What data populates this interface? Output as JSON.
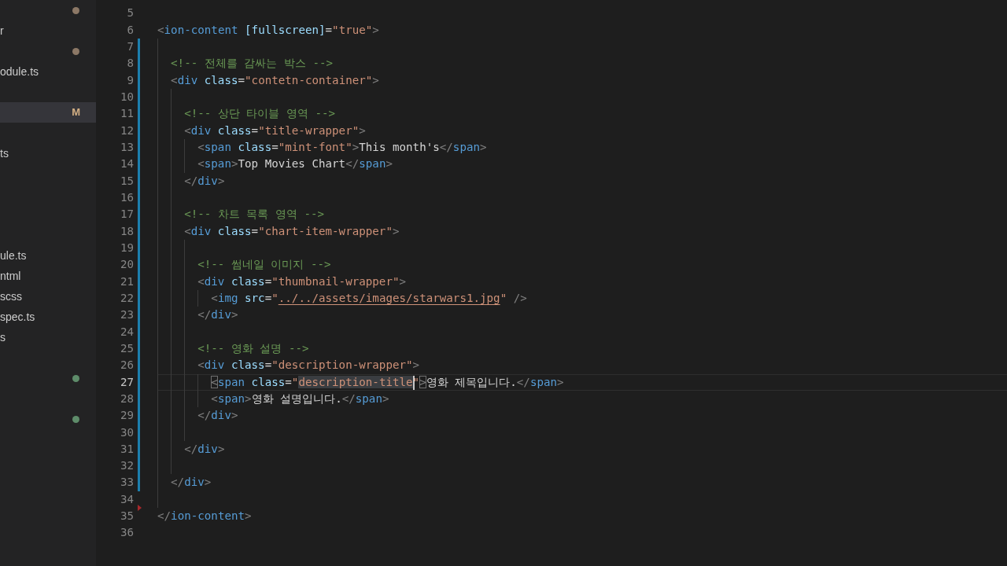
{
  "sidebar": {
    "items": [
      {
        "selected": false,
        "color": "#8c7866"
      },
      {
        "selected": false,
        "label": "r"
      },
      {
        "selected": false,
        "color": "#8c7866"
      },
      {
        "selected": false,
        "label": "odule.ts"
      },
      {
        "selected": false
      },
      {
        "selected": true,
        "badge": "M"
      },
      {
        "selected": false
      },
      {
        "selected": false,
        "label": "ts"
      },
      {
        "selected": false
      },
      {
        "selected": false
      },
      {
        "selected": false
      },
      {
        "selected": false
      },
      {
        "selected": false,
        "label": "ule.ts"
      },
      {
        "selected": false,
        "label": "ntml"
      },
      {
        "selected": false,
        "label": "scss"
      },
      {
        "selected": false,
        "label": "spec.ts"
      },
      {
        "selected": false,
        "label": "s"
      },
      {
        "selected": false
      },
      {
        "selected": false,
        "color": "#5e8c6a"
      },
      {
        "selected": false
      },
      {
        "selected": false,
        "color": "#5e8c6a"
      }
    ]
  },
  "editor": {
    "lines": [
      {
        "number": "5",
        "modified": false,
        "deleted": false,
        "current": false
      },
      {
        "number": "6",
        "modified": false,
        "deleted": false,
        "current": false,
        "tokens": [
          {
            "kind": "punct",
            "text": "<"
          },
          {
            "kind": "tag",
            "text": "ion-content"
          },
          {
            "kind": "attr",
            "text": " [fullscreen]"
          },
          {
            "kind": "op",
            "text": "="
          },
          {
            "kind": "string",
            "text": "\"true\""
          },
          {
            "kind": "punct",
            "text": ">"
          }
        ]
      },
      {
        "number": "7",
        "modified": true,
        "deleted": false,
        "current": false
      },
      {
        "number": "8",
        "modified": true,
        "deleted": false,
        "current": false,
        "tokens": [
          {
            "kind": "comment",
            "text": "  <!-- 전체를 감싸는 박스 -->"
          }
        ]
      },
      {
        "number": "9",
        "modified": true,
        "deleted": false,
        "current": false,
        "tokens": [
          {
            "kind": "punct",
            "text": "  <"
          },
          {
            "kind": "tag",
            "text": "div"
          },
          {
            "kind": "attr",
            "text": " class"
          },
          {
            "kind": "op",
            "text": "="
          },
          {
            "kind": "string",
            "text": "\"contetn-container\""
          },
          {
            "kind": "punct",
            "text": ">"
          }
        ]
      },
      {
        "number": "10",
        "modified": true,
        "deleted": false,
        "current": false
      },
      {
        "number": "11",
        "modified": true,
        "deleted": false,
        "current": false,
        "tokens": [
          {
            "kind": "comment",
            "text": "    <!-- 상단 타이블 영역 -->"
          }
        ]
      },
      {
        "number": "12",
        "modified": true,
        "deleted": false,
        "current": false,
        "tokens": [
          {
            "kind": "punct",
            "text": "    <"
          },
          {
            "kind": "tag",
            "text": "div"
          },
          {
            "kind": "attr",
            "text": " class"
          },
          {
            "kind": "op",
            "text": "="
          },
          {
            "kind": "string",
            "text": "\"title-wrapper\""
          },
          {
            "kind": "punct",
            "text": ">"
          }
        ]
      },
      {
        "number": "13",
        "modified": true,
        "deleted": false,
        "current": false,
        "tokens": [
          {
            "kind": "punct",
            "text": "      <"
          },
          {
            "kind": "tag",
            "text": "span"
          },
          {
            "kind": "attr",
            "text": " class"
          },
          {
            "kind": "op",
            "text": "="
          },
          {
            "kind": "string",
            "text": "\"mint-font\""
          },
          {
            "kind": "punct",
            "text": ">"
          },
          {
            "kind": "text",
            "text": "This month's"
          },
          {
            "kind": "punct",
            "text": "</"
          },
          {
            "kind": "tag",
            "text": "span"
          },
          {
            "kind": "punct",
            "text": ">"
          }
        ]
      },
      {
        "number": "14",
        "modified": true,
        "deleted": false,
        "current": false,
        "tokens": [
          {
            "kind": "punct",
            "text": "      <"
          },
          {
            "kind": "tag",
            "text": "span"
          },
          {
            "kind": "punct",
            "text": ">"
          },
          {
            "kind": "text",
            "text": "Top Movies Chart"
          },
          {
            "kind": "punct",
            "text": "</"
          },
          {
            "kind": "tag",
            "text": "span"
          },
          {
            "kind": "punct",
            "text": ">"
          }
        ]
      },
      {
        "number": "15",
        "modified": true,
        "deleted": false,
        "current": false,
        "tokens": [
          {
            "kind": "punct",
            "text": "    </"
          },
          {
            "kind": "tag",
            "text": "div"
          },
          {
            "kind": "punct",
            "text": ">"
          }
        ]
      },
      {
        "number": "16",
        "modified": true,
        "deleted": false,
        "current": false
      },
      {
        "number": "17",
        "modified": true,
        "deleted": false,
        "current": false,
        "tokens": [
          {
            "kind": "comment",
            "text": "    <!-- 차트 목록 영역 -->"
          }
        ]
      },
      {
        "number": "18",
        "modified": true,
        "deleted": false,
        "current": false,
        "tokens": [
          {
            "kind": "punct",
            "text": "    <"
          },
          {
            "kind": "tag",
            "text": "div"
          },
          {
            "kind": "attr",
            "text": " class"
          },
          {
            "kind": "op",
            "text": "="
          },
          {
            "kind": "string",
            "text": "\"chart-item-wrapper\""
          },
          {
            "kind": "punct",
            "text": ">"
          }
        ]
      },
      {
        "number": "19",
        "modified": true,
        "deleted": false,
        "current": false
      },
      {
        "number": "20",
        "modified": true,
        "deleted": false,
        "current": false,
        "tokens": [
          {
            "kind": "comment",
            "text": "      <!-- 썸네일 이미지 -->"
          }
        ]
      },
      {
        "number": "21",
        "modified": true,
        "deleted": false,
        "current": false,
        "tokens": [
          {
            "kind": "punct",
            "text": "      <"
          },
          {
            "kind": "tag",
            "text": "div"
          },
          {
            "kind": "attr",
            "text": " class"
          },
          {
            "kind": "op",
            "text": "="
          },
          {
            "kind": "string",
            "text": "\"thumbnail-wrapper\""
          },
          {
            "kind": "punct",
            "text": ">"
          }
        ]
      },
      {
        "number": "22",
        "modified": true,
        "deleted": false,
        "current": false,
        "tokens": [
          {
            "kind": "punct",
            "text": "        <"
          },
          {
            "kind": "tag",
            "text": "img"
          },
          {
            "kind": "attr",
            "text": " src"
          },
          {
            "kind": "op",
            "text": "="
          },
          {
            "kind": "string",
            "text": "\""
          },
          {
            "kind": "link",
            "text": "../../assets/images/starwars1.jpg"
          },
          {
            "kind": "string",
            "text": "\""
          },
          {
            "kind": "punct",
            "text": " />"
          }
        ]
      },
      {
        "number": "23",
        "modified": true,
        "deleted": false,
        "current": false,
        "tokens": [
          {
            "kind": "punct",
            "text": "      </"
          },
          {
            "kind": "tag",
            "text": "div"
          },
          {
            "kind": "punct",
            "text": ">"
          }
        ]
      },
      {
        "number": "24",
        "modified": true,
        "deleted": false,
        "current": false
      },
      {
        "number": "25",
        "modified": true,
        "deleted": false,
        "current": false,
        "tokens": [
          {
            "kind": "comment",
            "text": "      <!-- 영화 설명 -->"
          }
        ]
      },
      {
        "number": "26",
        "modified": true,
        "deleted": false,
        "current": false,
        "tokens": [
          {
            "kind": "punct",
            "text": "      <"
          },
          {
            "kind": "tag",
            "text": "div"
          },
          {
            "kind": "attr",
            "text": " class"
          },
          {
            "kind": "op",
            "text": "="
          },
          {
            "kind": "string",
            "text": "\"description-wrapper\""
          },
          {
            "kind": "punct",
            "text": ">"
          }
        ]
      },
      {
        "number": "27",
        "modified": true,
        "deleted": false,
        "current": true,
        "tokens": [
          {
            "kind": "bracket",
            "text": "        <"
          },
          {
            "kind": "tag",
            "text": "span"
          },
          {
            "kind": "attr",
            "text": " class"
          },
          {
            "kind": "op",
            "text": "="
          },
          {
            "kind": "string",
            "text": "\""
          },
          {
            "kind": "match",
            "text": "description-title"
          },
          {
            "kind": "cursor"
          },
          {
            "kind": "string",
            "text": "\""
          },
          {
            "kind": "bracket",
            "text": ">"
          },
          {
            "kind": "text",
            "text": "영화 제목입니다."
          },
          {
            "kind": "punct",
            "text": "</"
          },
          {
            "kind": "tag",
            "text": "span"
          },
          {
            "kind": "punct",
            "text": ">"
          }
        ]
      },
      {
        "number": "28",
        "modified": true,
        "deleted": false,
        "current": false,
        "tokens": [
          {
            "kind": "punct",
            "text": "        <"
          },
          {
            "kind": "tag",
            "text": "span"
          },
          {
            "kind": "punct",
            "text": ">"
          },
          {
            "kind": "text",
            "text": "영화 설명입니다."
          },
          {
            "kind": "punct",
            "text": "</"
          },
          {
            "kind": "tag",
            "text": "span"
          },
          {
            "kind": "punct",
            "text": ">"
          }
        ]
      },
      {
        "number": "29",
        "modified": true,
        "deleted": false,
        "current": false,
        "tokens": [
          {
            "kind": "punct",
            "text": "      </"
          },
          {
            "kind": "tag",
            "text": "div"
          },
          {
            "kind": "punct",
            "text": ">"
          }
        ]
      },
      {
        "number": "30",
        "modified": true,
        "deleted": false,
        "current": false
      },
      {
        "number": "31",
        "modified": true,
        "deleted": false,
        "current": false,
        "tokens": [
          {
            "kind": "punct",
            "text": "    </"
          },
          {
            "kind": "tag",
            "text": "div"
          },
          {
            "kind": "punct",
            "text": ">"
          }
        ]
      },
      {
        "number": "32",
        "modified": true,
        "deleted": false,
        "current": false
      },
      {
        "number": "33",
        "modified": true,
        "deleted": false,
        "current": false,
        "tokens": [
          {
            "kind": "punct",
            "text": "  </"
          },
          {
            "kind": "tag",
            "text": "div"
          },
          {
            "kind": "punct",
            "text": ">"
          }
        ]
      },
      {
        "number": "34",
        "modified": false,
        "deleted": true,
        "current": false
      },
      {
        "number": "35",
        "modified": false,
        "deleted": false,
        "current": false,
        "tokens": [
          {
            "kind": "punct",
            "text": "</"
          },
          {
            "kind": "tag",
            "text": "ion-content"
          },
          {
            "kind": "punct",
            "text": ">"
          }
        ]
      },
      {
        "number": "36",
        "modified": false,
        "deleted": false,
        "current": false
      }
    ]
  }
}
